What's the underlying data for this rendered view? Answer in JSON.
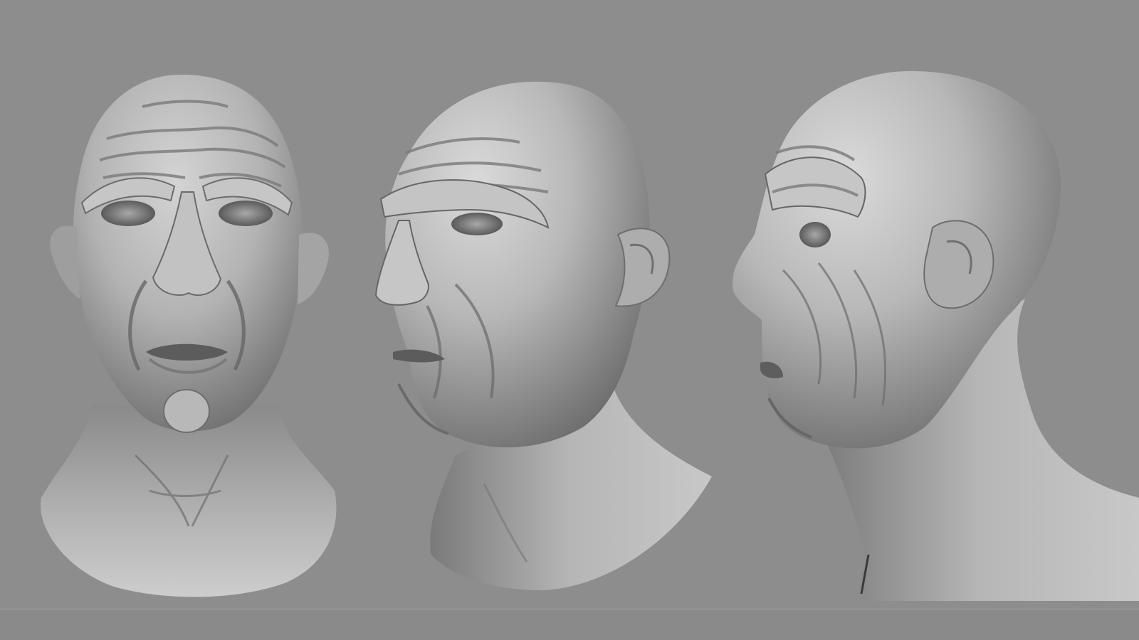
{
  "scene": {
    "description_free": true,
    "background_color": "#8d8d8d",
    "sculpt_color": "#b9b9b9",
    "shadow_color": "#5e5e5e",
    "highlight_color": "#d8d8d8",
    "views": [
      {
        "id": "front",
        "icon": "head-front-view"
      },
      {
        "id": "three-quarter",
        "icon": "head-three-quarter-view"
      },
      {
        "id": "profile",
        "icon": "head-profile-view"
      }
    ]
  }
}
